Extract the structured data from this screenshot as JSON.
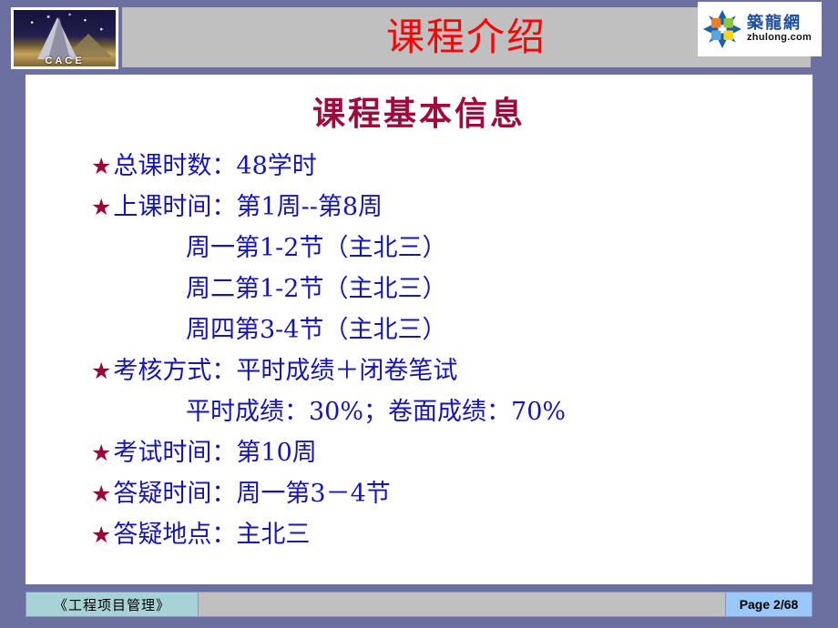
{
  "slide": {
    "title": "课程介绍",
    "heading": "课程基本信息",
    "logo": {
      "caption": "CACE",
      "icon": "pyramid-logo-icon"
    },
    "brand": {
      "cn": "築龍網",
      "en": "zhulong.com",
      "icon": "zhulong-pinwheel-icon"
    },
    "lines": [
      {
        "bullet": "★",
        "text": "总课时数：48学时",
        "indent": "bullet"
      },
      {
        "bullet": "★",
        "text": "上课时间：第1周--第8周",
        "indent": "bullet"
      },
      {
        "bullet": "",
        "text": "周一第1-2节（主北三）",
        "indent": "sub"
      },
      {
        "bullet": "",
        "text": "周二第1-2节（主北三）",
        "indent": "sub"
      },
      {
        "bullet": "",
        "text": "周四第3-4节（主北三）",
        "indent": "sub"
      },
      {
        "bullet": "★",
        "text": "考核方式：平时成绩＋闭卷笔试",
        "indent": "bullet"
      },
      {
        "bullet": "",
        "text": "平时成绩：30%；卷面成绩：70%",
        "indent": "sub"
      },
      {
        "bullet": "★",
        "text": "考试时间：第10周",
        "indent": "bullet"
      },
      {
        "bullet": "★",
        "text": "答疑时间：周一第3－4节",
        "indent": "bullet"
      },
      {
        "bullet": "★",
        "text": "答疑地点：主北三",
        "indent": "bullet"
      }
    ],
    "footer": {
      "left": "《工程项目管理》",
      "page": "Page 2/68"
    },
    "colors": {
      "frame": "#6c70a0",
      "title_band": "#c0c0c0",
      "title_text": "#ff0000",
      "heading_text": "#9e0b3d",
      "body_text": "#1515b0",
      "star": "#9c0035",
      "footer_left_bg": "#a8d3d6",
      "footer_page_bg": "#9ac8f8"
    }
  }
}
